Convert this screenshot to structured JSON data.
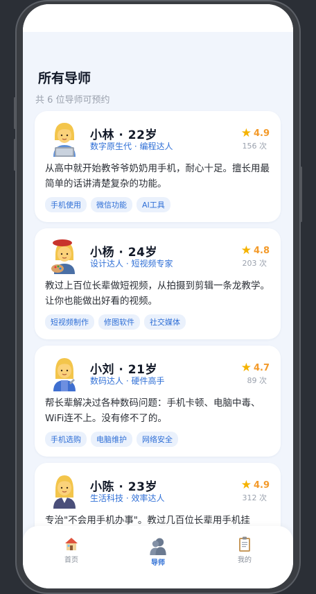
{
  "header": {
    "title": "所有导师",
    "subtitle": "共 6 位导师可预约"
  },
  "mentors": [
    {
      "name": "小林 · 22岁",
      "roles": "数字原生代 · 编程达人",
      "rating": "4.9",
      "sessions": "156 次",
      "description": "从高中就开始教爷爷奶奶用手机，耐心十足。擅长用最简单的话讲清楚复杂的功能。",
      "tags": [
        "手机使用",
        "微信功能",
        "AI工具"
      ]
    },
    {
      "name": "小杨 · 24岁",
      "roles": "设计达人 · 短视频专家",
      "rating": "4.8",
      "sessions": "203 次",
      "description": "教过上百位长辈做短视频，从拍摄到剪辑一条龙教学。让你也能做出好看的视频。",
      "tags": [
        "短视频制作",
        "修图软件",
        "社交媒体"
      ]
    },
    {
      "name": "小刘 · 21岁",
      "roles": "数码达人 · 硬件高手",
      "rating": "4.7",
      "sessions": "89 次",
      "description": "帮长辈解决过各种数码问题：手机卡顿、电脑中毒、WiFi连不上。没有修不了的。",
      "tags": [
        "手机选购",
        "电脑维护",
        "网络安全"
      ]
    },
    {
      "name": "小陈 · 23岁",
      "roles": "生活科技 · 效率达人",
      "rating": "4.9",
      "sessions": "312 次",
      "description": "专治\"不会用手机办事\"。教过几百位长辈用手机挂",
      "tags": []
    }
  ],
  "tabbar": {
    "items": [
      {
        "label": "首页",
        "icon": "house-icon"
      },
      {
        "label": "导师",
        "icon": "mentor-icon"
      },
      {
        "label": "我的",
        "icon": "clipboard-icon"
      }
    ]
  },
  "colors": {
    "accent": "#2f6fd6",
    "rating": "#f39a2a",
    "star": "#f5b301",
    "page_bg": "#f1f5fc"
  }
}
